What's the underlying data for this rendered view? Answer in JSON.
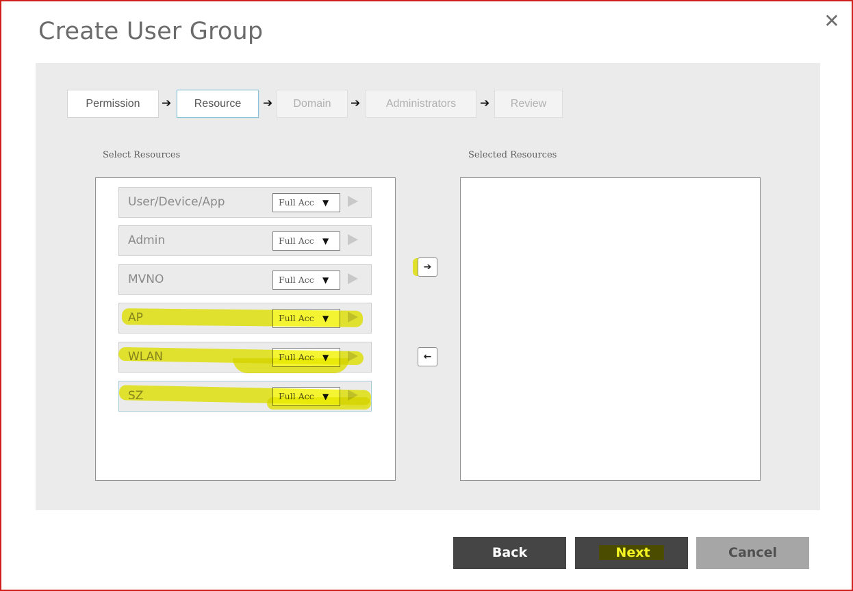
{
  "dialog": {
    "title": "Create User Group",
    "close_icon": "close-x-icon"
  },
  "wizard": {
    "steps": [
      {
        "label": "Permission",
        "state": "completed"
      },
      {
        "label": "Resource",
        "state": "active"
      },
      {
        "label": "Domain",
        "state": "disabled"
      },
      {
        "label": "Administrators",
        "state": "disabled"
      },
      {
        "label": "Review",
        "state": "disabled"
      }
    ],
    "separator_icon": "arrow-right-icon",
    "separator_glyph": "➔"
  },
  "select_resources": {
    "label": "Select Resources",
    "items": [
      {
        "name": "User/Device/App",
        "access": "Full Access",
        "access_visible": "Full Acc",
        "highlighted": false
      },
      {
        "name": "Admin",
        "access": "Full Access",
        "access_visible": "Full Acc",
        "highlighted": false
      },
      {
        "name": "MVNO",
        "access": "Full Access",
        "access_visible": "Full Acc",
        "highlighted": false
      },
      {
        "name": "AP",
        "access": "Full Access",
        "access_visible": "Full Acc",
        "highlighted": true
      },
      {
        "name": "WLAN",
        "access": "Full Access",
        "access_visible": "Full Acc",
        "highlighted": true
      },
      {
        "name": "SZ",
        "access": "Full Access",
        "access_visible": "Full Acc",
        "highlighted": true
      }
    ],
    "caret_glyph": "▼"
  },
  "transfer": {
    "add_glyph": "➔",
    "remove_glyph": "🡐",
    "add_highlighted": true
  },
  "selected_resources": {
    "label": "Selected Resources",
    "items": []
  },
  "footer": {
    "back_label": "Back",
    "next_label": "Next",
    "cancel_label": "Cancel"
  },
  "colors": {
    "frame_border": "#d0201d",
    "highlight": "#f2f20e",
    "button_dark": "#454545",
    "button_disabled": "#a6a6a6",
    "panel_bg": "#ebebeb"
  }
}
